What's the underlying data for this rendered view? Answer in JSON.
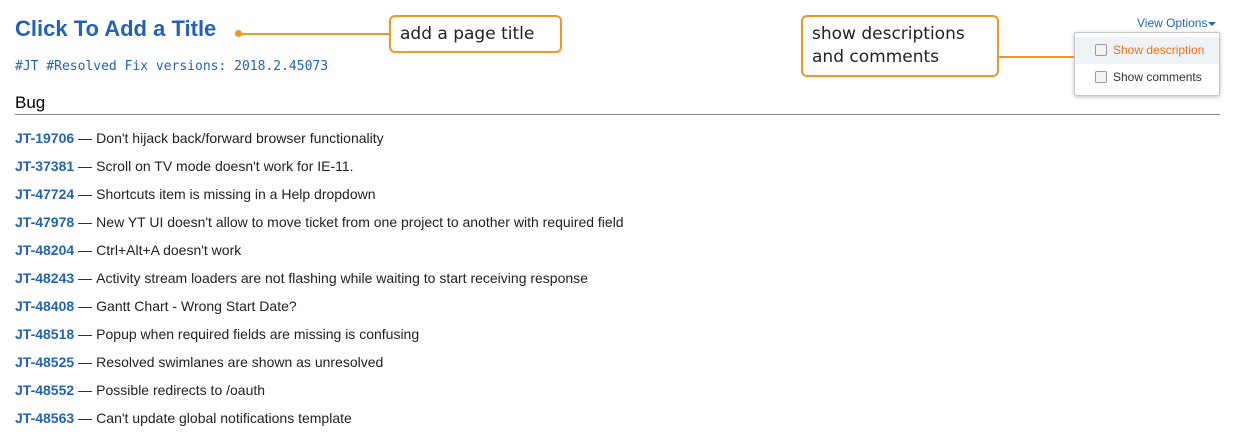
{
  "page": {
    "title": "Click To Add a Title",
    "query": "#JT #Resolved Fix versions: 2018.2.45073"
  },
  "section": {
    "heading": "Bug",
    "separator": "—"
  },
  "issues": [
    {
      "id": "JT-19706",
      "summary": "Don't hijack back/forward browser functionality"
    },
    {
      "id": "JT-37381",
      "summary": "Scroll on TV mode doesn't work for IE-11."
    },
    {
      "id": "JT-47724",
      "summary": "Shortcuts item is missing in a Help dropdown"
    },
    {
      "id": "JT-47978",
      "summary": "New YT UI doesn't allow to move ticket from one project to another with required field"
    },
    {
      "id": "JT-48204",
      "summary": "Ctrl+Alt+A doesn't work"
    },
    {
      "id": "JT-48243",
      "summary": "Activity stream loaders are not flashing while waiting to start receiving response"
    },
    {
      "id": "JT-48408",
      "summary": "Gantt Chart - Wrong Start Date?"
    },
    {
      "id": "JT-48518",
      "summary": "Popup when required fields are missing is confusing"
    },
    {
      "id": "JT-48525",
      "summary": "Resolved swimlanes are shown as unresolved"
    },
    {
      "id": "JT-48552",
      "summary": "Possible redirects to /oauth"
    },
    {
      "id": "JT-48563",
      "summary": "Can't update global notifications template"
    }
  ],
  "view_options": {
    "label": "View Options",
    "items": [
      {
        "label": "Show description",
        "checked": false,
        "highlighted": true
      },
      {
        "label": "Show comments",
        "checked": false,
        "highlighted": false
      }
    ]
  },
  "annotations": {
    "title_callout": "add a page title",
    "options_callout_line1": "show descriptions",
    "options_callout_line2": "and comments"
  },
  "colors": {
    "link": "#2263b8",
    "callout_border": "#f0962d",
    "highlight_text": "#e8711c"
  }
}
